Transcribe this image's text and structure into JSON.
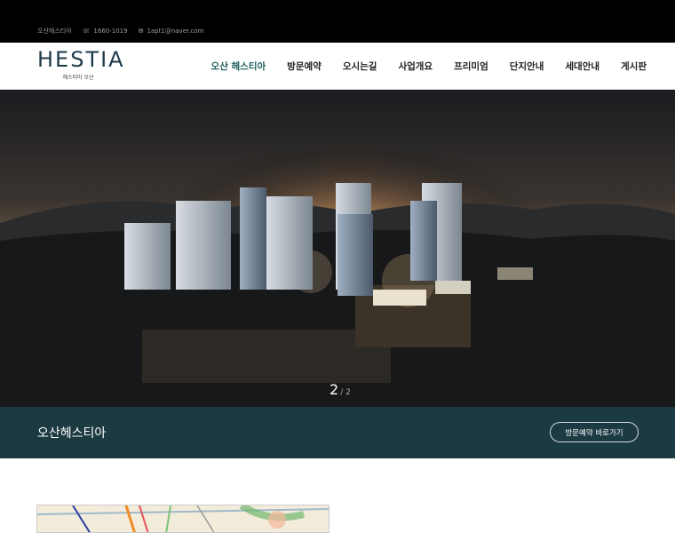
{
  "topbar": {
    "site_name": "오산헤스티아",
    "phone": "1660-1019",
    "email": "1apt1@naver.com",
    "phone_icon": "phone-icon",
    "mail_icon": "mail-icon"
  },
  "logo": {
    "main": "HESTIA",
    "sub": "헤스티아 오산"
  },
  "nav": {
    "items": [
      {
        "label": "오산 헤스티아"
      },
      {
        "label": "방문예약"
      },
      {
        "label": "오시는길"
      },
      {
        "label": "사업개요"
      },
      {
        "label": "프리미엄"
      },
      {
        "label": "단지안내"
      },
      {
        "label": "세대안내"
      },
      {
        "label": "게시판"
      }
    ],
    "active_color": "#1e5c5c"
  },
  "hero": {
    "current": "2",
    "total": "/ 2"
  },
  "band": {
    "title": "오산헤스티아",
    "button": "방문예약 바로가기",
    "color": "#1b3a42"
  }
}
